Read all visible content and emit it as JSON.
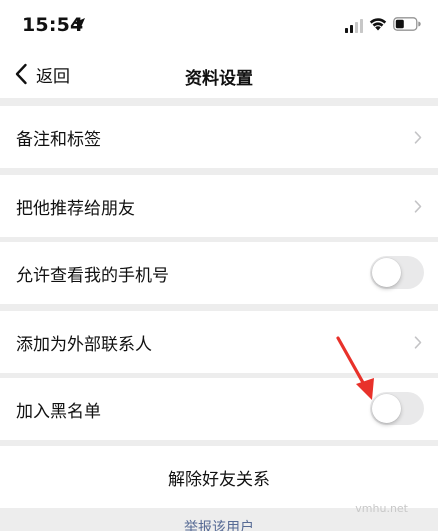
{
  "status_bar": {
    "time": "15:54"
  },
  "nav": {
    "back_label": "返回",
    "title": "资料设置"
  },
  "rows": [
    {
      "label": "备注和标签",
      "control": "chevron"
    },
    {
      "label": "把他推荐给朋友",
      "control": "chevron"
    },
    {
      "label": "允许查看我的手机号",
      "control": "toggle",
      "on": false
    },
    {
      "label": "添加为外部联系人",
      "control": "chevron"
    },
    {
      "label": "加入黑名单",
      "control": "toggle",
      "on": false
    }
  ],
  "action": {
    "label": "解除好友关系"
  },
  "footer": {
    "report_label": "举报该用户",
    "watermark": "vmhu.net"
  },
  "colors": {
    "background": "#ededed",
    "link": "#576b95",
    "toggle_off": "#e9e9ea",
    "annotation": "#e8312a"
  },
  "icons": [
    "location-arrow-icon",
    "signal-icon",
    "wifi-icon",
    "battery-icon",
    "back-chevron-icon",
    "chevron-right-icon",
    "red-arrow-icon"
  ]
}
